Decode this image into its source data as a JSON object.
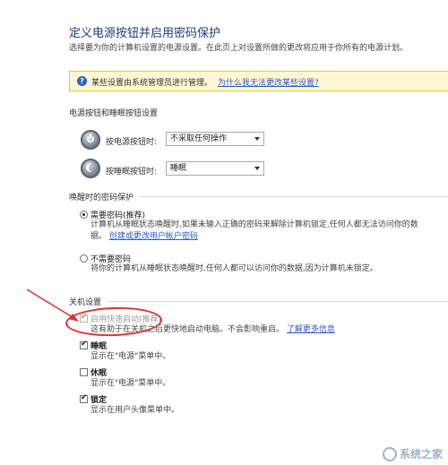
{
  "header": {
    "title": "定义电源按钮并启用密码保护",
    "subtitle": "选择要为你的计算机设置的电源设置。在此页上对设置所做的更改将应用于你所有的电源计划。"
  },
  "banner": {
    "icon": "help-shield-icon",
    "text": "某些设置由系统管理员进行管理。",
    "link": "为什么我无法更改某些设置?"
  },
  "power_buttons": {
    "heading": "电源按钮和睡眠按钮设置",
    "power_button": {
      "label": "按电源按钮时:",
      "value": "不采取任何操作"
    },
    "sleep_button": {
      "label": "按睡眠按钮时:",
      "value": "睡眠"
    }
  },
  "wake_password": {
    "heading": "唤醒时的密码保护",
    "require": {
      "label": "需要密码(推荐)",
      "checked": true,
      "desc": "计算机从睡眠状态唤醒时,如果未输入正确的密码来解除计算机锁定,任何人都无法访问你的数",
      "desc2": "据。",
      "link": "创建或更改用户帐户密码"
    },
    "no_require": {
      "label": "不需要密码",
      "checked": false,
      "desc": "将你的计算机从睡眠状态唤醒时,任何人都可以访问你的数据,因为计算机未锁定。"
    }
  },
  "shutdown": {
    "heading": "关机设置",
    "fast_startup": {
      "label": "启用快速启动(推荐)",
      "checked": true,
      "desc": "这有助于在关机之后更快地启动电脑。不会影响重启。",
      "link": "了解更多信息"
    },
    "sleep": {
      "label": "睡眠",
      "checked": true,
      "desc": "显示在\"电源\"菜单中。"
    },
    "hibernate": {
      "label": "休眠",
      "checked": false,
      "desc": "显示在\"电源\"菜单中。"
    },
    "lock": {
      "label": "锁定",
      "checked": true,
      "desc": "显示在用户头像菜单中。"
    }
  },
  "watermark": {
    "text": "系统之家"
  },
  "colors": {
    "annotation": "#e03030",
    "link": "#2a5bc9",
    "banner_bg": "#fff7d2"
  }
}
